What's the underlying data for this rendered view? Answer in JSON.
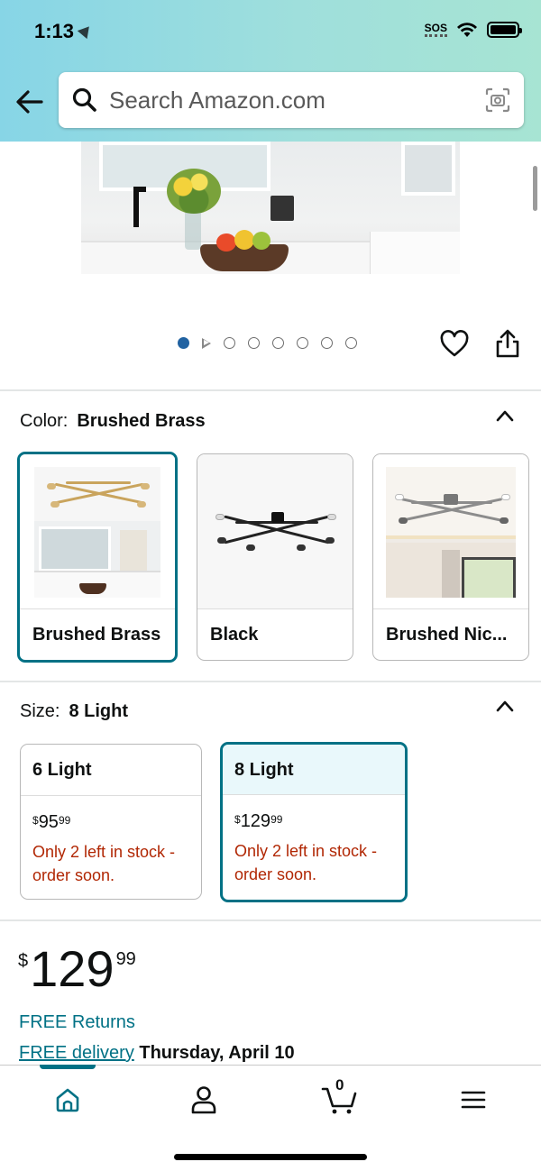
{
  "status_bar": {
    "time": "1:13",
    "sos": "SOS"
  },
  "search": {
    "placeholder": "Search Amazon.com"
  },
  "carousel": {
    "total_dots": 8,
    "active_index": 0
  },
  "color": {
    "label": "Color:",
    "selected": "Brushed Brass",
    "options": [
      {
        "name": "Brushed Brass",
        "selected": true
      },
      {
        "name": "Black",
        "selected": false
      },
      {
        "name": "Brushed Nic...",
        "selected": false
      }
    ]
  },
  "size": {
    "label": "Size:",
    "selected": "8 Light",
    "options": [
      {
        "name": "6 Light",
        "price_symbol": "$",
        "price_whole": "95",
        "price_fraction": "99",
        "stock": "Only 2 left in stock - order soon.",
        "selected": false
      },
      {
        "name": "8 Light",
        "price_symbol": "$",
        "price_whole": "129",
        "price_fraction": "99",
        "stock": "Only 2 left in stock - order soon.",
        "selected": true
      }
    ]
  },
  "price": {
    "symbol": "$",
    "whole": "129",
    "fraction": "99"
  },
  "returns": "FREE Returns",
  "delivery": {
    "link": "FREE delivery",
    "date": "Thursday, April 10"
  },
  "nav": {
    "cart_count": "0",
    "active": "home"
  },
  "colors": {
    "accent": "#007185",
    "stock": "#b12704",
    "dot_active": "#2162a1"
  }
}
